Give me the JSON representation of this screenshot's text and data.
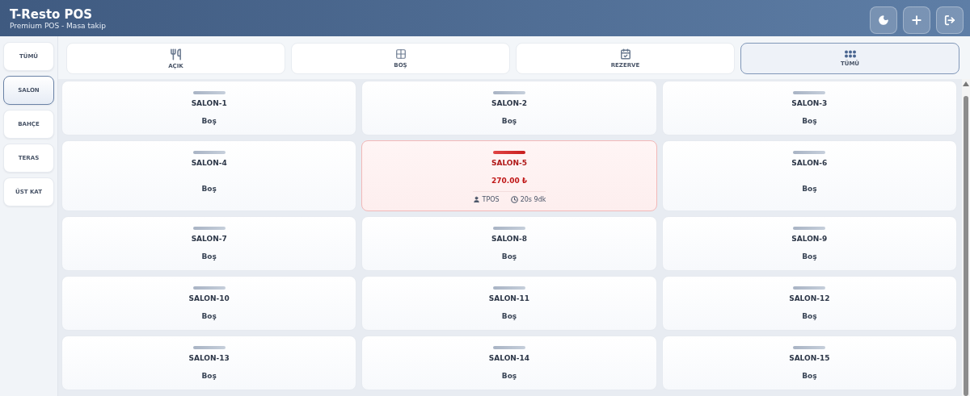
{
  "header": {
    "title": "T-Resto POS",
    "subtitle": "Premium POS - Masa takip",
    "actions": [
      {
        "kind": "theme"
      },
      {
        "kind": "add"
      },
      {
        "kind": "logout"
      }
    ]
  },
  "areas": [
    {
      "label": "TÜMÜ",
      "selected": false
    },
    {
      "label": "SALON",
      "selected": true
    },
    {
      "label": "BAHÇE",
      "selected": false
    },
    {
      "label": "TERAS",
      "selected": false
    },
    {
      "label": "ÜST KAT",
      "selected": false
    }
  ],
  "filters": [
    {
      "kind": "open",
      "label": "AÇIK",
      "selected": false
    },
    {
      "kind": "empty",
      "label": "BOŞ",
      "selected": false
    },
    {
      "kind": "reserved",
      "label": "REZERVE",
      "selected": false
    },
    {
      "kind": "all",
      "label": "TÜMÜ",
      "selected": true
    }
  ],
  "tables": [
    {
      "name": "SALON-1",
      "kind": "free",
      "status": "Boş"
    },
    {
      "name": "SALON-2",
      "kind": "free",
      "status": "Boş"
    },
    {
      "name": "SALON-3",
      "kind": "free",
      "status": "Boş"
    },
    {
      "name": "SALON-4",
      "kind": "free",
      "status": "Boş"
    },
    {
      "name": "SALON-5",
      "kind": "occupied",
      "amount": "270.00 ₺",
      "user": "TPOS",
      "duration": "20s 9dk"
    },
    {
      "name": "SALON-6",
      "kind": "free",
      "status": "Boş"
    },
    {
      "name": "SALON-7",
      "kind": "free",
      "status": "Boş"
    },
    {
      "name": "SALON-8",
      "kind": "free",
      "status": "Boş"
    },
    {
      "name": "SALON-9",
      "kind": "free",
      "status": "Boş"
    },
    {
      "name": "SALON-10",
      "kind": "free",
      "status": "Boş"
    },
    {
      "name": "SALON-11",
      "kind": "free",
      "status": "Boş"
    },
    {
      "name": "SALON-12",
      "kind": "free",
      "status": "Boş"
    },
    {
      "name": "SALON-13",
      "kind": "free",
      "status": "Boş"
    },
    {
      "name": "SALON-14",
      "kind": "free",
      "status": "Boş"
    },
    {
      "name": "SALON-15",
      "kind": "free",
      "status": "Boş"
    }
  ]
}
